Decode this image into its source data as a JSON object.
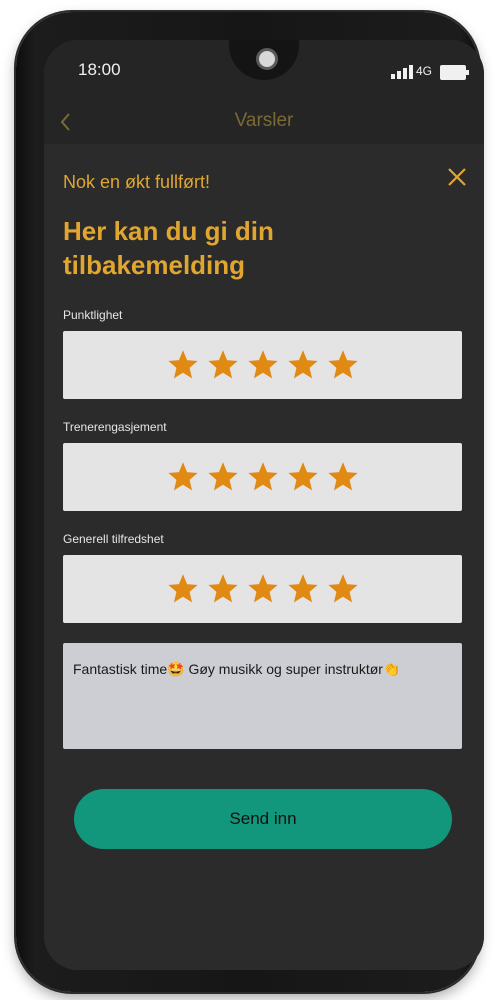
{
  "status_bar": {
    "time": "18:00",
    "network": "4G",
    "icons": [
      "signal-icon",
      "battery-icon"
    ]
  },
  "nav": {
    "title": "Varsler",
    "back_icon": "chevron-left-icon"
  },
  "feedback": {
    "subtitle": "Nok en økt fullført!",
    "heading": "Her kan du gi din tilbakemelding",
    "close_icon": "close-icon",
    "ratings": [
      {
        "label": "Punktlighet",
        "stars": 5,
        "max": 5
      },
      {
        "label": "Trenerengasjement",
        "stars": 5,
        "max": 5
      },
      {
        "label": "Generell tilfredshet",
        "stars": 5,
        "max": 5
      }
    ],
    "comment": "Fantastisk time🤩 Gøy musikk og super instruktør👏",
    "submit_label": "Send inn"
  },
  "colors": {
    "accent": "#e0a630",
    "star": "#e08a14",
    "submit_button": "#12967c",
    "background": "#2b2b2b"
  }
}
